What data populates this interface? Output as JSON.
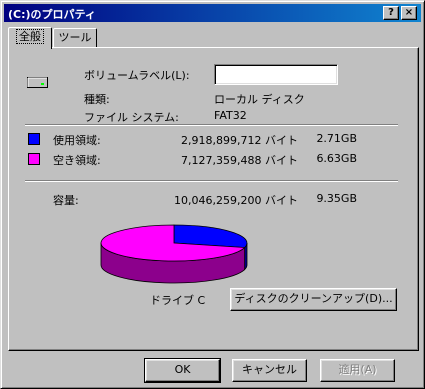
{
  "window": {
    "title": "(C:)のプロパティ",
    "help_button": "?",
    "close_button": "×"
  },
  "tabs": [
    {
      "label": "全般",
      "active": true
    },
    {
      "label": "ツール",
      "active": false
    }
  ],
  "general": {
    "drive_icon": "hard-drive-icon",
    "volume_label_caption": "ボリュームラベル(L):",
    "volume_label_value": "",
    "type_caption": "種類:",
    "type_value": "ローカル ディスク",
    "fs_caption": "ファイル システム:",
    "fs_value": "FAT32",
    "used": {
      "label": "使用領域:",
      "bytes": "2,918,899,712 バイト",
      "size": "2.71GB",
      "color": "#0000ff"
    },
    "free": {
      "label": "空き領域:",
      "bytes": "7,127,359,488 バイト",
      "size": "6.63GB",
      "color": "#ff00ff"
    },
    "capacity": {
      "label": "容量:",
      "bytes": "10,046,259,200 バイト",
      "size": "9.35GB"
    },
    "drive_label": "ドライブ C",
    "cleanup_button": "ディスクのクリーンアップ(D)..."
  },
  "chart_data": {
    "type": "pie",
    "categories": [
      "使用領域",
      "空き領域"
    ],
    "values": [
      2918899712,
      7127359488
    ],
    "colors": [
      "#0000ff",
      "#ff00ff"
    ]
  },
  "footer": {
    "ok": "OK",
    "cancel": "キャンセル",
    "apply": "適用(A)"
  }
}
